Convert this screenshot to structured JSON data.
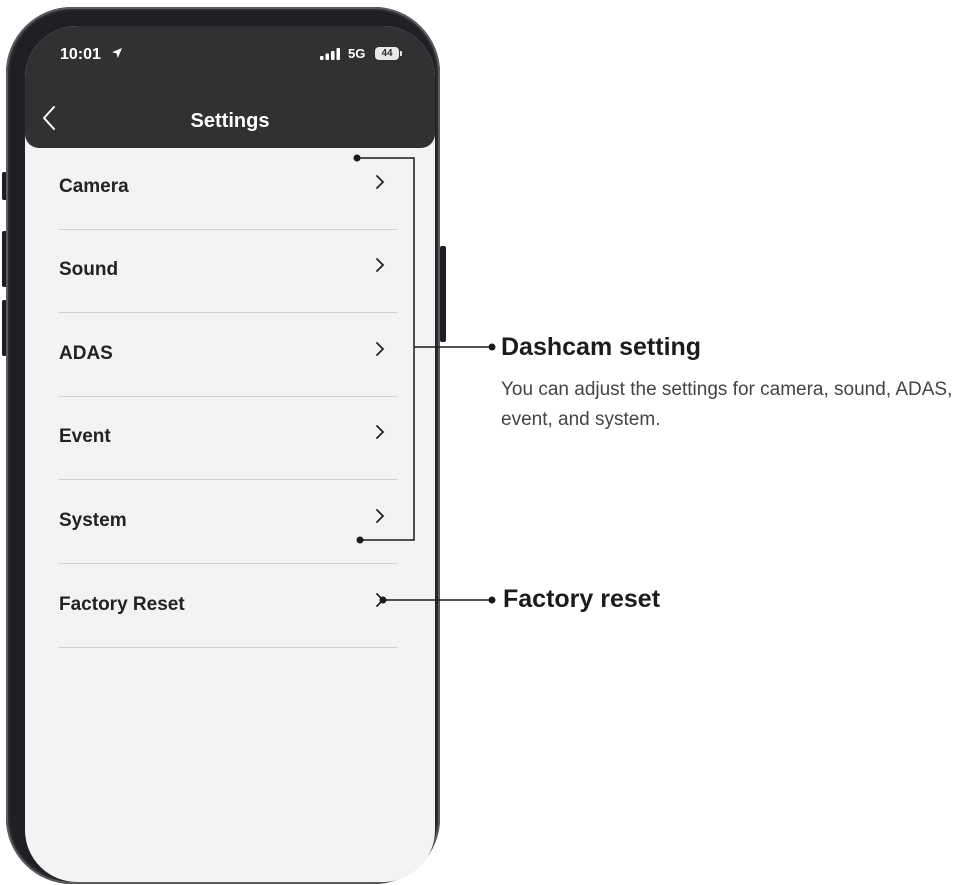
{
  "status_bar": {
    "time": "10:01",
    "network": "5G",
    "battery": "44"
  },
  "header": {
    "title": "Settings",
    "back_icon": "chevron-left-icon"
  },
  "menu": {
    "items": [
      {
        "label": "Camera"
      },
      {
        "label": "Sound"
      },
      {
        "label": "ADAS"
      },
      {
        "label": "Event"
      },
      {
        "label": "System"
      },
      {
        "label": "Factory Reset"
      }
    ]
  },
  "annotations": {
    "dashcam": {
      "title": "Dashcam setting",
      "description": "You can adjust the settings for camera, sound, ADAS, event, and system."
    },
    "factory": {
      "title": "Factory reset"
    }
  },
  "colors": {
    "header_bg": "#2f3133",
    "screen_bg": "#f2f3f2",
    "frame": "#1f2023"
  }
}
